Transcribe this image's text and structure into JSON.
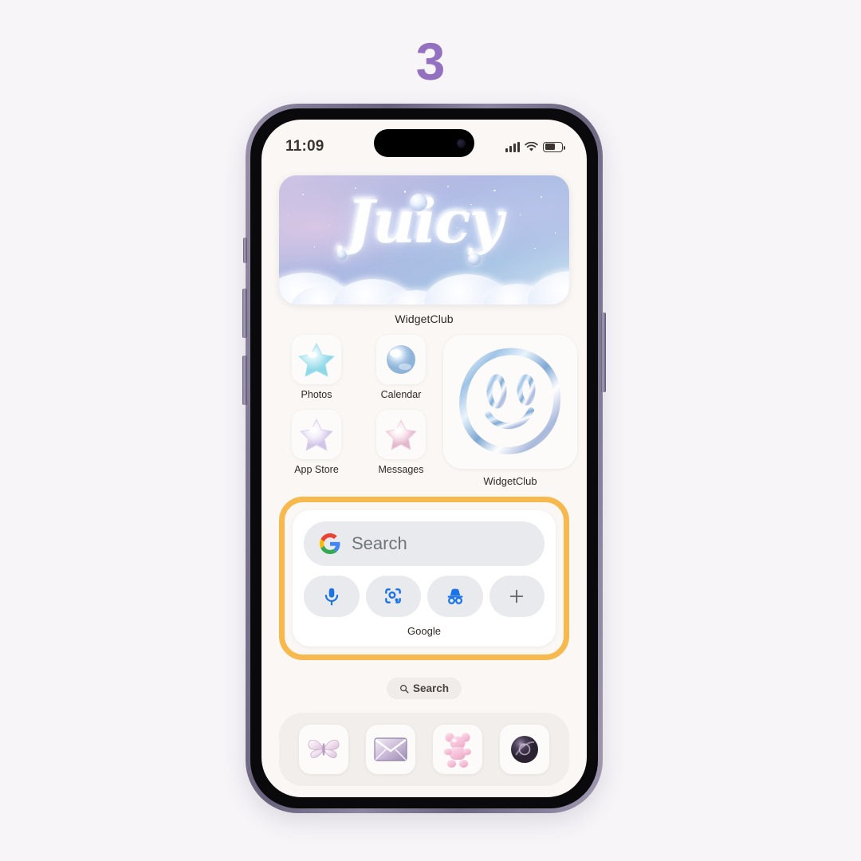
{
  "step": {
    "number": "3"
  },
  "colors": {
    "page_background": "#f7f5f8",
    "step_number": "#9370c0",
    "highlight_border": "#f7b84e",
    "screen_background": "#faf7f4",
    "google_blue": "#1a73e8",
    "google_field": "#e8eaed",
    "phone_frame": "#7e7791"
  },
  "status_bar": {
    "time": "11:09",
    "signal_icon": "cellular-bars-icon",
    "wifi_icon": "wifi-icon",
    "battery_icon": "battery-icon",
    "battery_level": 62
  },
  "widgets": {
    "juicy": {
      "word": "Juicy",
      "label": "WidgetClub",
      "art": "bubble-letters-clouds-starry-sky"
    },
    "smiley": {
      "label": "WidgetClub",
      "art": "chrome-smiley-face"
    },
    "google": {
      "logo_icon": "google-g-icon",
      "search_placeholder": "Search",
      "label": "Google",
      "actions": [
        {
          "name": "voice-search",
          "icon": "microphone-icon"
        },
        {
          "name": "google-lens",
          "icon": "lens-camera-icon"
        },
        {
          "name": "incognito",
          "icon": "incognito-hat-icon"
        },
        {
          "name": "more",
          "icon": "plus-icon"
        }
      ]
    }
  },
  "apps": [
    {
      "label": "Photos",
      "icon": "cyan-star-icon"
    },
    {
      "label": "Calendar",
      "icon": "pearl-sphere-icon"
    },
    {
      "label": "App Store",
      "icon": "lavender-star-icon"
    },
    {
      "label": "Messages",
      "icon": "pink-star-icon"
    }
  ],
  "search_pill": {
    "label": "Search",
    "icon": "magnifier-icon"
  },
  "dock": [
    {
      "name": "butterfly-app",
      "icon": "butterfly-icon"
    },
    {
      "name": "mail-app",
      "icon": "envelope-icon"
    },
    {
      "name": "gummy-bear-app",
      "icon": "gummy-bear-icon"
    },
    {
      "name": "camera-app",
      "icon": "dark-orb-icon"
    }
  ]
}
